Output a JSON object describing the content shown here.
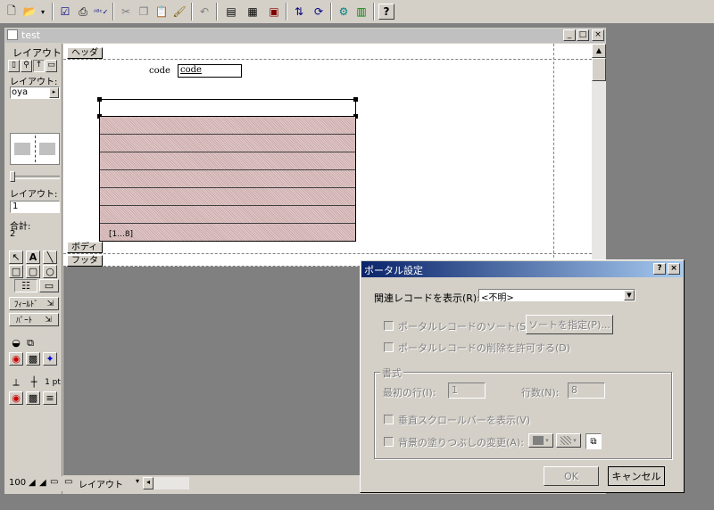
{
  "toolbar": {
    "icons": [
      "new-icon",
      "open-icon",
      "checkmark-icon",
      "print-icon",
      "spellcheck-icon",
      "cut-icon",
      "copy-icon",
      "paste-icon",
      "format-painter-icon",
      "undo-icon",
      "layout-mode-icon",
      "browse-mode-icon",
      "find-mode-icon",
      "sort-icon",
      "refresh-icon",
      "script-icon",
      "layout-setup-icon",
      "help-icon"
    ]
  },
  "window": {
    "title": "test",
    "controls": [
      "_",
      "□",
      "×"
    ]
  },
  "sidebar": {
    "layout_label": "レイアウト",
    "layout_menu_label": "レイアウト:",
    "layout_menu_value": "oya",
    "layout_number_label": "レイアウト:",
    "layout_number_value": "1",
    "total_label": "合計:",
    "total_value": "2",
    "field_button": "ﾌｨｰﾙﾄﾞ",
    "part_button": "ﾊﾟｰﾄ",
    "line_width": "1 pt"
  },
  "layout": {
    "header_part": "ヘッダ",
    "body_part": "ボディ",
    "footer_part": "フッタ",
    "field_label": "code",
    "field_name": "code",
    "portal_range": "[1...8]"
  },
  "status_bar": {
    "zoom": "100",
    "mode": "レイアウト"
  },
  "dialog": {
    "title": "ポータル設定",
    "help_button": "?",
    "close_button": "×",
    "related_label": "関連レコードを表示(R):",
    "related_value": "<不明>",
    "sort_checkbox": "ポータルレコードのソート(S)",
    "sort_button": "ソートを指定(P)...",
    "delete_checkbox": "ポータルレコードの削除を許可する(D)",
    "format_group": "書式",
    "first_row_label": "最初の行(I):",
    "first_row_value": "1",
    "rows_label": "行数(N):",
    "rows_value": "8",
    "scrollbar_checkbox": "垂直スクロールバーを表示(V)",
    "background_checkbox": "背景の塗りつぶしの変更(A):",
    "ok_button": "OK",
    "cancel_button": "キャンセル"
  }
}
